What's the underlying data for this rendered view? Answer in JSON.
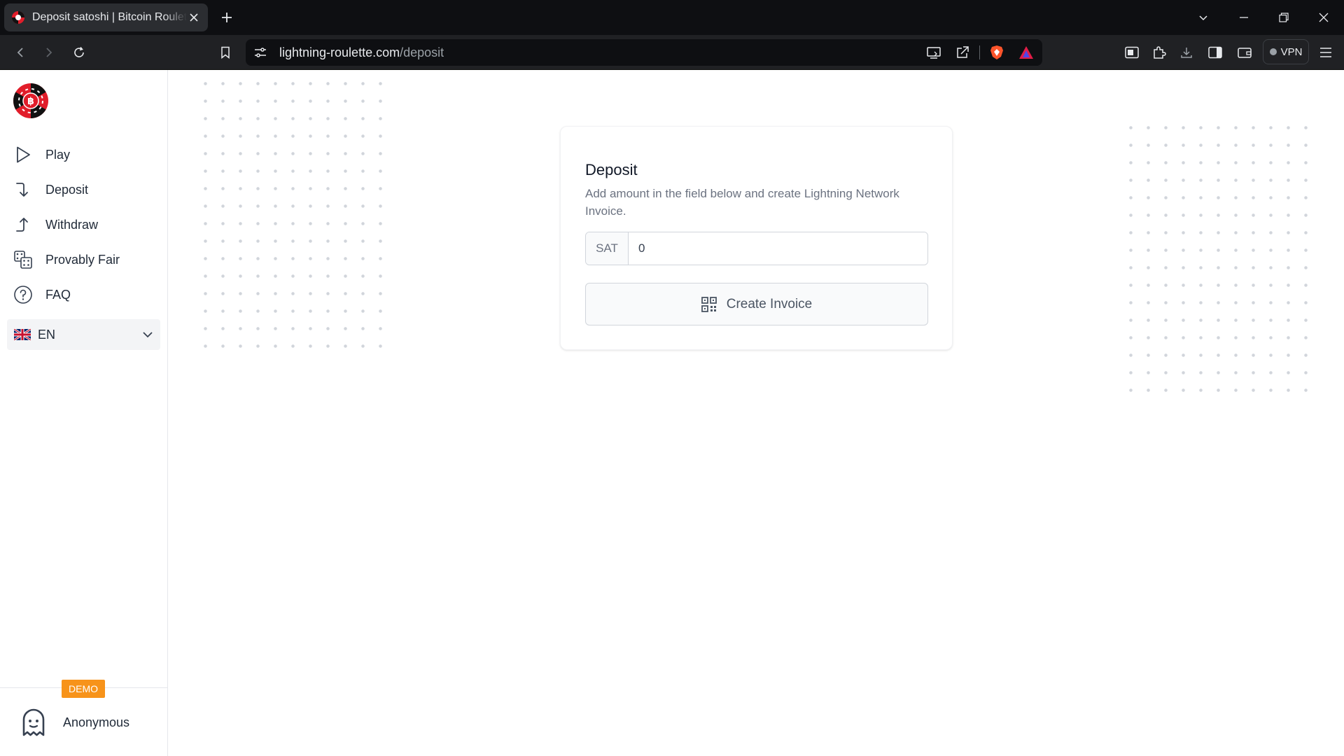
{
  "browser": {
    "tab_title": "Deposit satoshi | Bitcoin Roulette",
    "url_host": "lightning-roulette.com",
    "url_path": "/deposit",
    "vpn_label": "VPN"
  },
  "sidebar": {
    "items": [
      {
        "label": "Play",
        "icon": "play-icon"
      },
      {
        "label": "Deposit",
        "icon": "arrow-down-icon"
      },
      {
        "label": "Withdraw",
        "icon": "arrow-up-icon"
      },
      {
        "label": "Provably Fair",
        "icon": "dice-icon"
      },
      {
        "label": "FAQ",
        "icon": "question-circle-icon"
      }
    ],
    "language": "EN",
    "demo_badge": "DEMO",
    "user_name": "Anonymous"
  },
  "deposit": {
    "title": "Deposit",
    "description": "Add amount in the field below and create Lightning Network Invoice.",
    "unit": "SAT",
    "amount_placeholder": "0",
    "button_label": "Create Invoice"
  },
  "colors": {
    "brand_red": "#e11d2a",
    "demo_orange": "#f7931a"
  }
}
